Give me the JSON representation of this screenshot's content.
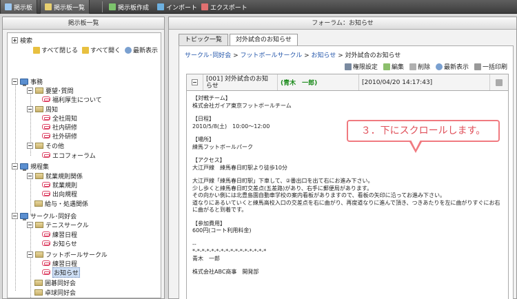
{
  "toolbar": {
    "tab1": "掲示板",
    "tab2": "掲示板一覧",
    "create": "掲示板作成",
    "import": "インポート",
    "export": "エクスポート"
  },
  "left_panel": {
    "title": "掲示板一覧",
    "search": "検索",
    "close_all": "すべて閉じる",
    "open_all": "すべて開く",
    "refresh": "最新表示",
    "tree": {
      "jimu": "事務",
      "youbou": "要望･質問",
      "fukuri": "福利厚生について",
      "shuuchi": "周知",
      "zensha": "全社周知",
      "shanai_kenshu": "社内研修",
      "shagai_kenshu": "社外研修",
      "sonota": "その他",
      "eco": "エコフォーラム",
      "kitei": "規程集",
      "shugyo_kankei": "就業規則関係",
      "shugyo": "就業規則",
      "shucchou": "出向規程",
      "kyuyo": "給与・処遇関係",
      "circle": "サークル･同好会",
      "tennis": "テニスサークル",
      "tennis_renshu": "練習日程",
      "tennis_oshirase": "お知らせ",
      "football": "フットボールサークル",
      "football_renshu": "練習日程",
      "football_oshirase": "お知らせ",
      "igo": "囲碁同好会",
      "takkyu": "卓球同好会"
    }
  },
  "right_panel": {
    "title": "フォーラム：お知らせ",
    "tab_topics": "トピック一覧",
    "tab_current": "対外試合のお知らせ",
    "breadcrumb": {
      "c1": "サークル･同好会",
      "sep": " > ",
      "c2": "フットボールサークル",
      "c3": "お知らせ",
      "c4": "対外試合のお知らせ"
    },
    "actions": {
      "permissions": "権限設定",
      "edit": "編集",
      "delete": "削除",
      "refresh": "最新表示",
      "print": "一括印刷"
    },
    "post": {
      "title_line1": "[001] 対外試合のお知",
      "title_line2": "らせ",
      "author": "(青木　一郎)",
      "date": "[2010/04/20 14:17:43]",
      "body": [
        "【対戦チーム】\n株式会社ガイア東京フットボールチーム",
        "【日程】\n2010/5/8(土)　10:00～12:00",
        "【場所】\n練馬フットボールパーク",
        "【アクセス】\n大江戸線　練馬春日町駅より徒歩10分",
        "大江戸線「練馬春日町駅」下車して、②番出口を出て右にお進み下さい。\n少し歩くと練馬春日町交差点(五差路)があり、右手に郵便局があります。\nその向かい側には北豊島園自動車学校の案内看板がありますので、看板の矢印に沿ってお進み下さい。\n道なりにあるいていくと練馬高校入口の交差点を右に曲がり、再度道なりに進んで頂き、つきあたりを左に曲がりすぐにお右に曲がると到着です。",
        "【参加費用】\n600円(コート利用料金)",
        "--\n*-*-*-*-*-*-*-*-*-*-*-*-*-*-*-*\n 青木　一郎",
        " 株式会社ABC商事　開発部"
      ]
    }
  },
  "callout": "３．下にスクロールします。",
  "colors": {
    "callout": "#f07a80",
    "link": "#2255aa",
    "author": "#1a8a1a"
  }
}
